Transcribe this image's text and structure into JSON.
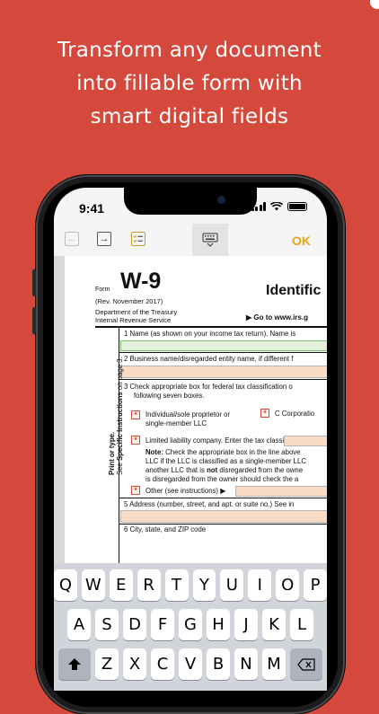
{
  "headline": {
    "line1": "Transform any document",
    "line2": "into fillable form with",
    "line3": "smart digital fields"
  },
  "status_bar": {
    "time": "9:41"
  },
  "toolbar": {
    "back_icon": "arrow-left-icon",
    "forward_icon": "arrow-right-icon",
    "checklist_icon": "checklist-icon",
    "keyboard_icon": "keyboard-icon",
    "ok_label": "OK",
    "ok_color": "#e8a41a"
  },
  "document": {
    "form_label": "Form",
    "form_title": "W-9",
    "revision": "(Rev. November 2017)",
    "department": "Department of the Treasury",
    "irs": "Internal Revenue Service",
    "heading": "Identific",
    "goto": "▶ Go to www.irs.g",
    "line1": "1  Name (as shown on your income tax return). Name is",
    "line2": "2  Business name/disregarded entity name, if different f",
    "line3a": "3  Check appropriate box for federal tax classification o",
    "line3b": "following seven boxes.",
    "opt_individual_1": "Individual/sole proprietor or",
    "opt_individual_2": "single-member LLC",
    "opt_ccorp": "C Corporatio",
    "opt_llc": "Limited liability company. Enter the tax classificati",
    "note_bold": "Note:",
    "note1": " Check the appropriate box in the line above",
    "note2": "LLC if the LLC is classified as a single-member LLC",
    "note3_a": "another LLC that is ",
    "note3_bold": "not",
    "note3_b": " disregarded from the owne",
    "note4": "is disregarded from the owner should check the a",
    "opt_other": "Other (see instructions) ▶",
    "line5": "5  Address (number, street, and apt. or suite no.) See in",
    "line6": "6  City, state, and ZIP code",
    "side_print": "Print or type.",
    "side_see": "See ",
    "side_specific": "Specific Instructions",
    "side_page": " on page 3.",
    "checkbox_mark": "*"
  },
  "keyboard": {
    "row1": [
      "Q",
      "W",
      "E",
      "R",
      "T",
      "Y",
      "U",
      "I",
      "O",
      "P"
    ],
    "row2": [
      "A",
      "S",
      "D",
      "F",
      "G",
      "H",
      "J",
      "K",
      "L"
    ],
    "row3": [
      "Z",
      "X",
      "C",
      "V",
      "B",
      "N",
      "M"
    ],
    "shift_icon": "shift-icon",
    "delete_icon": "delete-icon"
  },
  "colors": {
    "background": "#d5493d",
    "field_fill": "#f9dcc6",
    "field_active": "#e3f1dc"
  }
}
